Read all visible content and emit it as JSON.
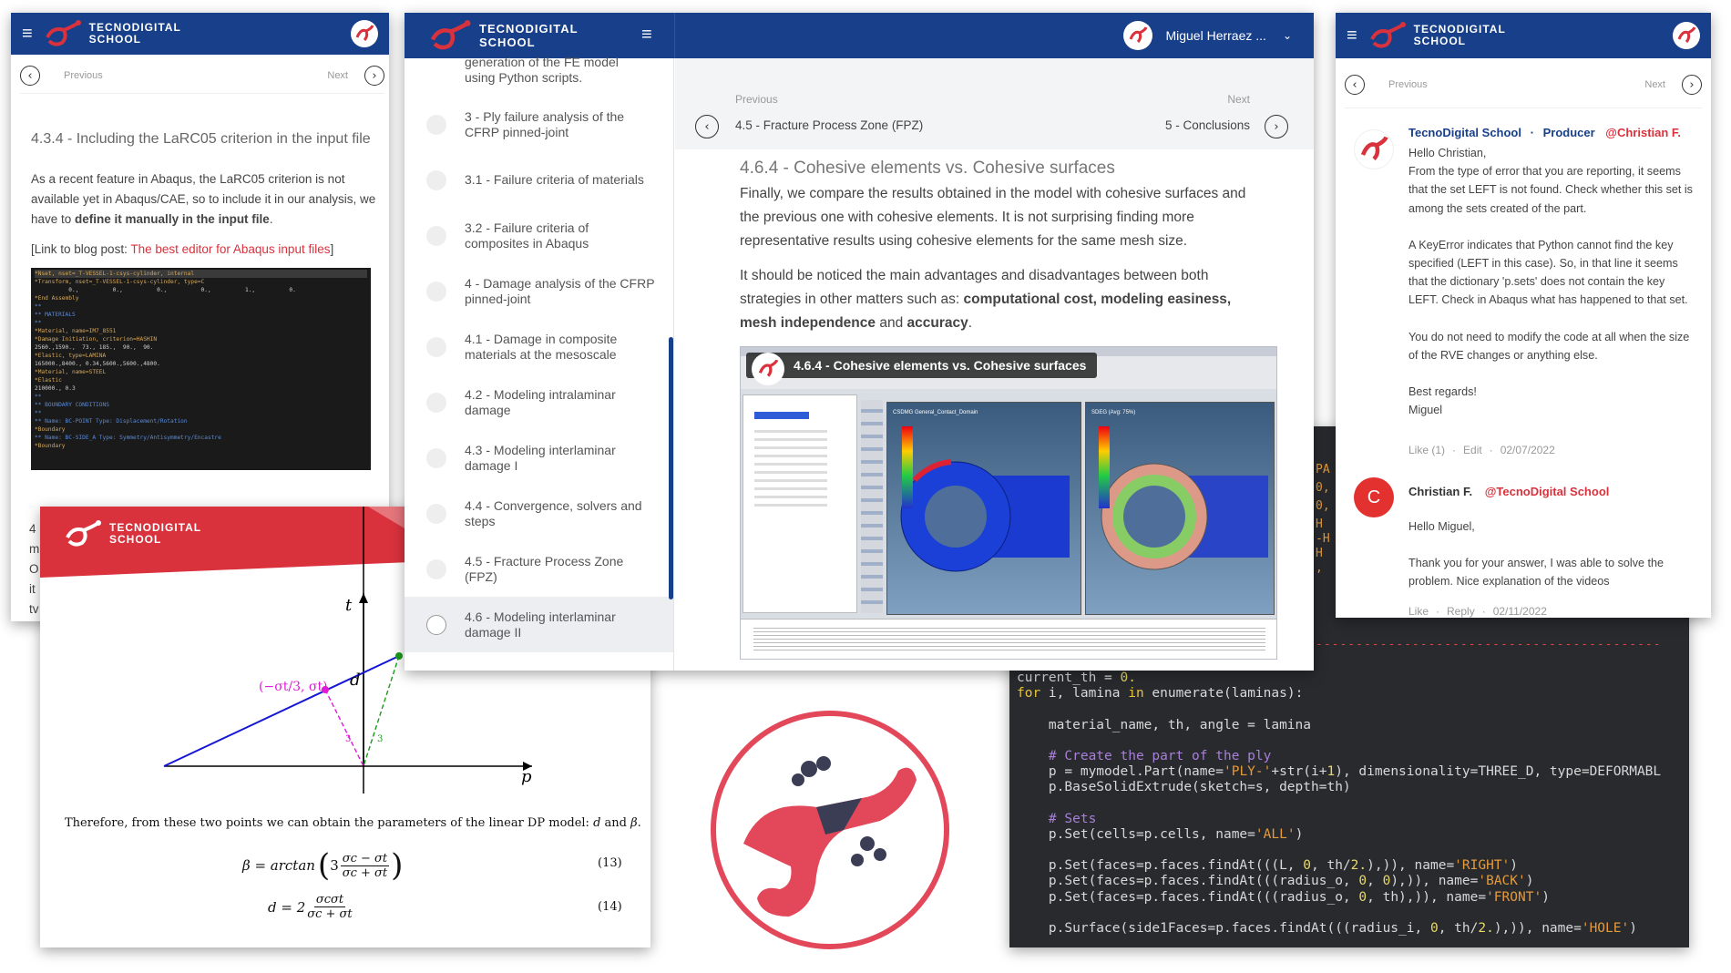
{
  "brand": {
    "line1": "TECNODIGITAL",
    "line2": "SCHOOL",
    "red": "#d9323d",
    "navy": "#173f8a"
  },
  "left_panel": {
    "prev": "Previous",
    "next": "Next",
    "heading": "4.3.4 - Including the LaRC05 criterion in the input file",
    "para1_a": "As a recent feature in Abaqus, the LaRC05 criterion is not available yet in Abaqus/CAE, so to include it in our analysis, we have to ",
    "para1_b": "define it manually in the input file",
    "para1_c": ".",
    "link_prefix": "[Link to blog post: ",
    "link_text": "The best editor for Abaqus input files",
    "link_suffix": "]",
    "code_lines": [
      "*Nset, nset=_T-VESSEL-1-csys-cylinder, internal",
      "",
      "*Transform, nset=_T-VESSEL-1-csys-cylinder, type=C",
      "          0.,          0.,          0.,          0.,          1.,          0.",
      "*End Assembly",
      "**",
      "** MATERIALS",
      "**",
      "*Material, name=IM7_8551",
      "*Damage Initiation, criterion=HASHIN",
      "2560.,1590.,  73., 185.,  90.,  90.",
      "*Elastic, type=LAMINA",
      "165000.,8400., 0.34,5600.,5600.,4800.",
      "*Material, name=STEEL",
      "*Elastic",
      "210000., 0.3",
      "**",
      "** BOUNDARY CONDITIONS",
      "**",
      "** Name: BC-POINT Type: Displacement/Rotation",
      "*Boundary",
      "",
      "** Name: BC-SIDE_A Type: Symmetry/Antisymmetry/Encastre",
      "*Boundary"
    ],
    "partial_letters": [
      "4",
      "m",
      "O",
      "it",
      "tv"
    ]
  },
  "dp_panel": {
    "t_label": "t",
    "p_label": "p",
    "d_label": "d",
    "point_label": "(−σt/3, σt)",
    "num3a": "3",
    "num3b": "3",
    "text_a": "Therefore, from these two points we can obtain the parameters of the linear DP model: ",
    "text_d": "d",
    "text_and": " and ",
    "text_beta": "β",
    "text_end": ".",
    "eq13_lhs": "β = arctan",
    "eq13_coef": "3",
    "eq13_num": "σc − σt",
    "eq13_den": "σc + σt",
    "eq13_no": "(13)",
    "eq14_lhs": "d = 2",
    "eq14_num": "σcσt",
    "eq14_den": "σc + σt",
    "eq14_no": "(14)"
  },
  "center_panel": {
    "user_name": "Miguel Herraez ...",
    "sidebar_top_text": "generation of the FE model using Python scripts.",
    "sidebar_items": [
      "3 - Ply failure analysis of the CFRP pinned-joint",
      "3.1 - Failure criteria of materials",
      "3.2 - Failure criteria of composites in Abaqus",
      "4 - Damage analysis of the CFRP pinned-joint",
      "4.1 - Damage in composite materials at the mesoscale",
      "4.2 - Modeling intralaminar damage",
      "4.3 - Modeling interlaminar damage I",
      "4.4 - Convergence, solvers and steps",
      "4.5 - Fracture Process Zone (FPZ)",
      "4.6 - Modeling interlaminar damage II"
    ],
    "prev_label": "Previous",
    "prev_title": "4.5 - Fracture Process Zone (FPZ)",
    "next_label": "Next",
    "next_title": "5 - Conclusions",
    "heading": "4.6.4 - Cohesive elements vs. Cohesive surfaces",
    "para1": "Finally, we compare the results obtained in the model with cohesive surfaces and the previous one with cohesive elements. It is not surprising finding more representative results using cohesive elements for the same mesh size.",
    "para2_a": "It should be noticed the main advantages and disadvantages between both strategies in other matters such as: ",
    "para2_b": "computational cost, modeling easiness, mesh independence",
    "para2_c": " and ",
    "para2_d": "accuracy",
    "para2_e": ".",
    "video_title": "4.6.4 - Cohesive elements vs. Cohesive surfaces",
    "video_legend_left": "CSDMG General_Contact_Domain",
    "video_legend_right": "SDEG (Avg: 75%)"
  },
  "right_panel": {
    "prev": "Previous",
    "next": "Next",
    "c1_author": "TecnoDigital School",
    "c1_sep": "·",
    "c1_role": "Producer",
    "c1_mention": "@Christian F.",
    "c1_lines": [
      "Hello Christian,",
      "From the type of error that you are reporting, it seems that the set LEFT is not found. Check whether this set is among the sets created of the part.",
      "A KeyError indicates that Python cannot find the key specified (LEFT in this case). So, in that line it seems that the dictionary 'p.sets' does not contain the key LEFT. Check in Abaqus what has happened to that set.",
      "You do not need to modify the code at all when the size of the RVE changes or anything else.",
      "Best regards!",
      "Miguel"
    ],
    "c1_like": "Like (1)",
    "c1_edit": "Edit",
    "c1_date": "02/07/2022",
    "c2_initial": "C",
    "c2_author": "Christian F.",
    "c2_mention": "@TecnoDigital School",
    "c2_lines": [
      "Hello Miguel,",
      "Thank you for your answer, I was able to solve the problem. Nice explanation of the videos"
    ],
    "c2_like": "Like",
    "c2_reply": "Reply",
    "c2_date": "02/11/2022"
  },
  "code_panel": {
    "partial_right": [
      "PA",
      "0,",
      "0,",
      "H",
      "-H",
      "H",
      ","
    ],
    "dashes": "-------------------------------------------",
    "lines": [
      {
        "t": "current_th = 0.",
        "c": "plain"
      },
      {
        "t": "for i, lamina in enumerate(laminas):",
        "c": "for"
      },
      {
        "t": "",
        "c": "plain"
      },
      {
        "t": "    material_name, th, angle = lamina",
        "c": "plain"
      },
      {
        "t": "",
        "c": "plain"
      },
      {
        "t": "    # Create the part of the ply",
        "c": "cm"
      },
      {
        "t": "    p = mymodel.Part(name='PLY-'+str(i+1), dimensionality=THREE_D, type=DEFORMABL",
        "c": "plain"
      },
      {
        "t": "    p.BaseSolidExtrude(sketch=s, depth=th)",
        "c": "plain"
      },
      {
        "t": "",
        "c": "plain"
      },
      {
        "t": "    # Sets",
        "c": "cm"
      },
      {
        "t": "    p.Set(cells=p.cells, name='ALL')",
        "c": "plain"
      },
      {
        "t": "",
        "c": "plain"
      },
      {
        "t": "    p.Set(faces=p.faces.findAt(((L, 0, th/2.),)), name='RIGHT')",
        "c": "plain"
      },
      {
        "t": "    p.Set(faces=p.faces.findAt(((radius_o, 0, 0),)), name='BACK')",
        "c": "plain"
      },
      {
        "t": "    p.Set(faces=p.faces.findAt(((radius_o, 0, th),)), name='FRONT')",
        "c": "plain"
      },
      {
        "t": "",
        "c": "plain"
      },
      {
        "t": "    p.Surface(side1Faces=p.faces.findAt(((radius_i, 0, th/2.),)), name='HOLE')",
        "c": "plain"
      }
    ]
  }
}
